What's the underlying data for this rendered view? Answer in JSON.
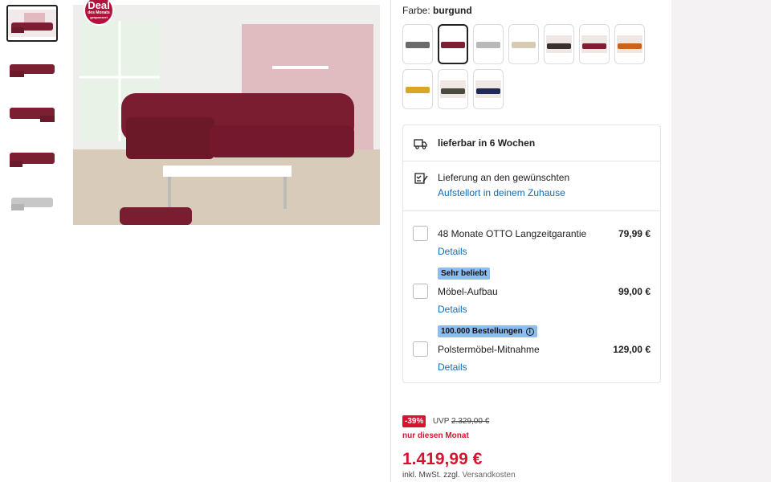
{
  "gallery": {
    "thumbnails": [
      {
        "name": "thumb-1",
        "color": "#7c1f33",
        "active": true
      },
      {
        "name": "thumb-2",
        "color": "#7c1f33",
        "active": false
      },
      {
        "name": "thumb-3",
        "color": "#7c1f33",
        "active": false
      },
      {
        "name": "thumb-4",
        "color": "#7c1f33",
        "active": false
      },
      {
        "name": "thumb-5",
        "color": "#c7c7c7",
        "active": false
      }
    ],
    "deal_badge": {
      "line1": "Deal",
      "line2": "des Monats",
      "line3": "gesponsert"
    }
  },
  "variant": {
    "label": "Farbe:",
    "value": "burgund",
    "swatches": [
      {
        "color": "#6b6b6b",
        "selected": false
      },
      {
        "color": "#7c1f33",
        "selected": true
      },
      {
        "color": "#b8b8b8",
        "selected": false
      },
      {
        "color": "#d8cbb4",
        "selected": false
      },
      {
        "color": "#3b3030",
        "selected": false
      },
      {
        "color": "#7c1f33",
        "selected": false
      },
      {
        "color": "#c96420",
        "selected": false
      },
      {
        "color": "#d9a726",
        "selected": false
      },
      {
        "color": "#4a4a3e",
        "selected": false
      },
      {
        "color": "#1f2a5a",
        "selected": false
      }
    ]
  },
  "delivery": {
    "time": "lieferbar in 6 Wochen",
    "place_line1": "Lieferung an den gewünschten",
    "place_link": "Aufstellort in deinem Zuhause"
  },
  "services": [
    {
      "tag": "",
      "name": "48 Monate OTTO Langzeitgarantie",
      "price": "79,99 €",
      "link": "Details"
    },
    {
      "tag": "Sehr beliebt",
      "name": "Möbel-Aufbau",
      "price": "99,00 €",
      "link": "Details"
    },
    {
      "tag": "100.000 Bestellungen",
      "name": "Polstermöbel-Mitnahme",
      "price": "129,00 €",
      "link": "Details"
    }
  ],
  "pricing": {
    "discount": "-39%",
    "uvp_label": "UVP",
    "uvp_price": "2.329,00 €",
    "promo": "nur diesen Monat",
    "price": "1.419,99 €",
    "tax_text": "inkl. MwSt. zzgl.",
    "shipping_text": "Versandkosten"
  },
  "colors": {
    "accent_red": "#d5152f",
    "link_blue": "#1a6ab2",
    "tag_blue": "#8cbcf0"
  }
}
